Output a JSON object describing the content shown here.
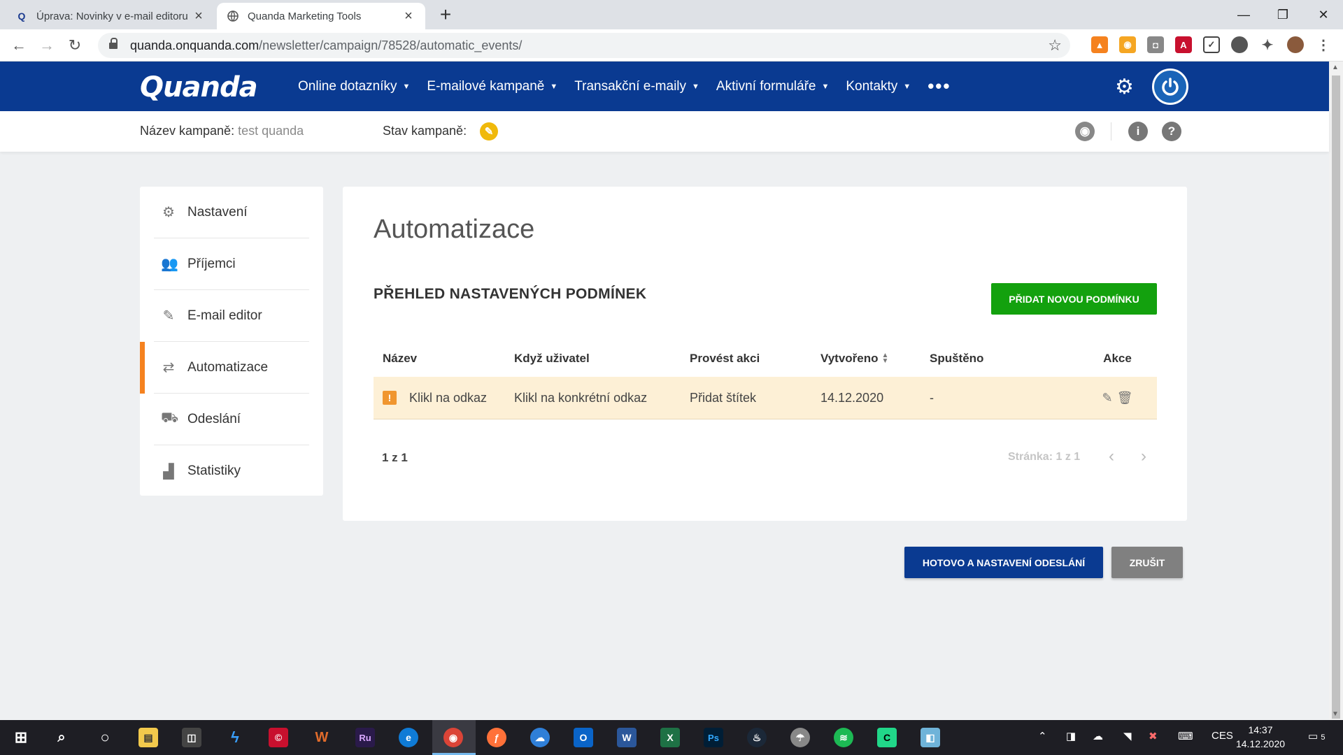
{
  "browser": {
    "tabs": [
      {
        "title": "Úprava: Novinky v e-mail editoru",
        "active": false
      },
      {
        "title": "Quanda Marketing Tools",
        "active": true
      }
    ],
    "url_host": "quanda.onquanda.com",
    "url_path": "/newsletter/campaign/78528/automatic_events/"
  },
  "app": {
    "logo": "Quanda",
    "menu": [
      {
        "label": "Online dotazníky"
      },
      {
        "label": "E-mailové kampaně"
      },
      {
        "label": "Transakční e-maily"
      },
      {
        "label": "Aktivní formuláře"
      },
      {
        "label": "Kontakty"
      }
    ],
    "menu_more": "•••",
    "accent": "#0a3a91"
  },
  "campaign": {
    "name_label": "Název kampaně:",
    "name_value": "test quanda",
    "status_label": "Stav kampaně:"
  },
  "sidebar": {
    "items": [
      {
        "label": "Nastavení",
        "icon": "gear-icon"
      },
      {
        "label": "Příjemci",
        "icon": "users-icon"
      },
      {
        "label": "E-mail editor",
        "icon": "edit-icon"
      },
      {
        "label": "Automatizace",
        "icon": "repeat-icon",
        "active": true
      },
      {
        "label": "Odeslání",
        "icon": "send-icon"
      },
      {
        "label": "Statistiky",
        "icon": "bar-chart-icon"
      }
    ]
  },
  "main": {
    "title": "Automatizace",
    "section_title": "PŘEHLED NASTAVENÝCH PODMÍNEK",
    "add_button": "PŘIDAT NOVOU PODMÍNKU",
    "columns": [
      "Název",
      "Když uživatel",
      "Provést akci",
      "Vytvořeno",
      "Spuštěno",
      "Akce"
    ],
    "rows": [
      {
        "name": "Klikl na odkaz",
        "when": "Klikl na konkrétní odkaz",
        "action": "Přidat štítek",
        "created": "14.12.2020",
        "run": "-"
      }
    ],
    "count": "1 z 1",
    "pager": "Stránka: 1 z 1"
  },
  "footer": {
    "done_button": "HOTOVO A NASTAVENÍ ODESLÁNÍ",
    "cancel_button": "ZRUŠIT"
  },
  "taskbar": {
    "lang": "CES",
    "time": "14:37",
    "date": "14.12.2020",
    "notifications": "5"
  }
}
